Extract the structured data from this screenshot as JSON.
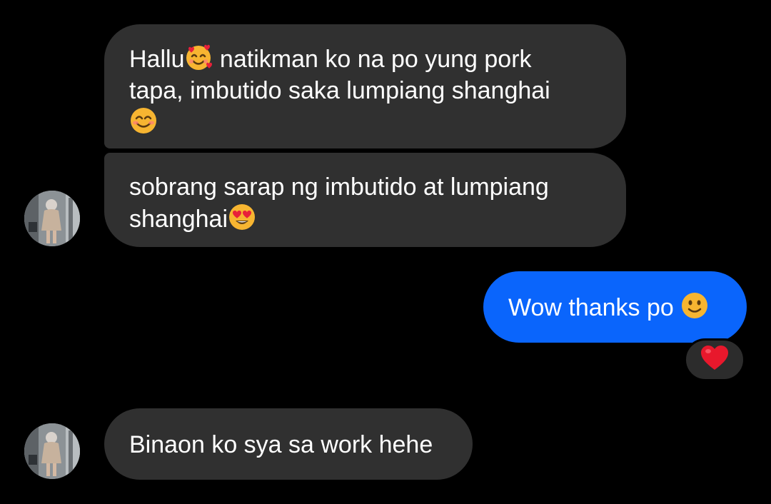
{
  "messages": [
    {
      "direction": "incoming",
      "text_parts": [
        "Hallu",
        " natikman ko na po yung pork",
        "tapa, imbutido saka lumpiang shanghai"
      ],
      "emojis": [
        "smiling-face-with-hearts",
        "smiling-face-with-smiling-eyes"
      ]
    },
    {
      "direction": "incoming",
      "text_parts": [
        "sobrang sarap ng imbutido at lumpiang",
        "shanghai"
      ],
      "emojis": [
        "smiling-face-with-heart-eyes"
      ]
    },
    {
      "direction": "outgoing",
      "text_parts": [
        "Wow thanks po "
      ],
      "emojis": [
        "slightly-smiling-face"
      ],
      "reaction": "red-heart"
    },
    {
      "direction": "incoming",
      "text_parts": [
        "Binaon ko sya sa work hehe"
      ],
      "emojis": []
    }
  ],
  "colors": {
    "background": "#000000",
    "incoming_bubble": "#303030",
    "outgoing_bubble": "#0a65fc",
    "text": "#ffffff",
    "reaction_bg": "#2c2c2c"
  }
}
